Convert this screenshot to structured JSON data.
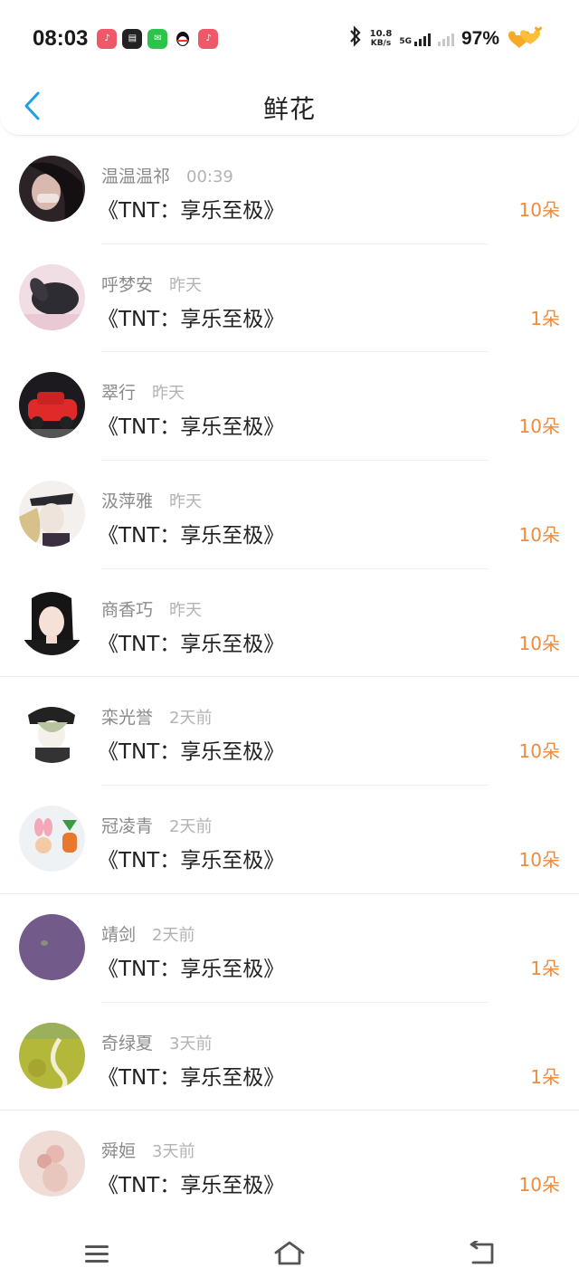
{
  "status": {
    "time": "08:03",
    "net_speed_value": "10.8",
    "net_speed_unit": "KB/s",
    "network_type": "5G",
    "battery": "97%",
    "app_icons": [
      {
        "name": "douyin-icon",
        "color": "#f0586a",
        "glyph": "♪"
      },
      {
        "name": "news-app-icon",
        "color": "#222222",
        "glyph": "▤"
      },
      {
        "name": "wechat-icon",
        "color": "#2dc24a",
        "glyph": "✉"
      },
      {
        "name": "qq-icon",
        "color": "#ffffff",
        "glyph": "🐧"
      },
      {
        "name": "douyin-icon-2",
        "color": "#f0586a",
        "glyph": "♪"
      }
    ]
  },
  "header": {
    "title": "鲜花",
    "back_icon": "chevron-left-icon",
    "accent": "#1e9fe6"
  },
  "items": [
    {
      "name": "温温温祁",
      "time": "00:39",
      "book": "《TNT：享乐至极》",
      "count": "10朵"
    },
    {
      "name": "呼梦安",
      "time": "昨天",
      "book": "《TNT：享乐至极》",
      "count": "1朵"
    },
    {
      "name": "翠行",
      "time": "昨天",
      "book": "《TNT：享乐至极》",
      "count": "10朵"
    },
    {
      "name": "汲萍雅",
      "time": "昨天",
      "book": "《TNT：享乐至极》",
      "count": "10朵"
    },
    {
      "name": "商香巧",
      "time": "昨天",
      "book": "《TNT：享乐至极》",
      "count": "10朵"
    },
    {
      "name": "栾光誉",
      "time": "2天前",
      "book": "《TNT：享乐至极》",
      "count": "10朵"
    },
    {
      "name": "冠凌青",
      "time": "2天前",
      "book": "《TNT：享乐至极》",
      "count": "10朵"
    },
    {
      "name": "靖剑",
      "time": "2天前",
      "book": "《TNT：享乐至极》",
      "count": "1朵"
    },
    {
      "name": "奇绿夏",
      "time": "3天前",
      "book": "《TNT：享乐至极》",
      "count": "1朵"
    },
    {
      "name": "舜姮",
      "time": "3天前",
      "book": "《TNT：享乐至极》",
      "count": "10朵"
    }
  ],
  "colors": {
    "count": "#f08a3c",
    "meta": "#8a8a8a",
    "title_text": "#222222"
  },
  "navbar": {
    "menu_icon": "menu-icon",
    "home_icon": "home-icon",
    "back_icon": "back-icon"
  }
}
